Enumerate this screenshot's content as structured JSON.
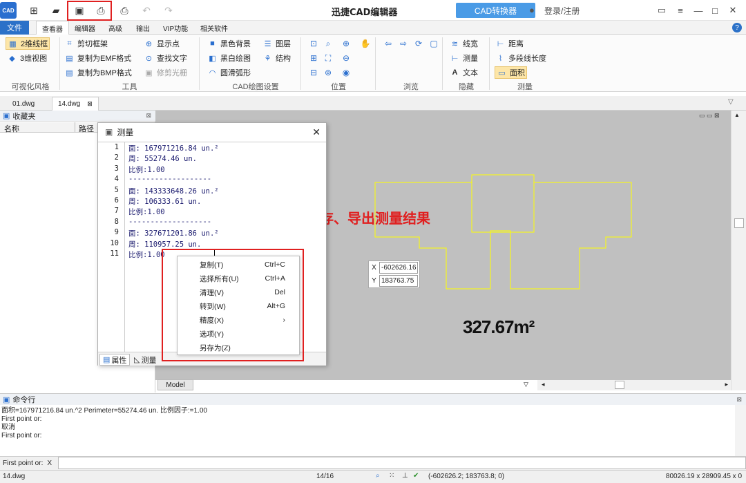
{
  "titlebar": {
    "logo_text": "CAD",
    "title": "迅捷CAD编辑器",
    "converter_label": "CAD转换器",
    "login_label": "登录/注册"
  },
  "ribbon_tabs": [
    "文件",
    "查看器",
    "编辑器",
    "高级",
    "输出",
    "VIP功能",
    "相关软件"
  ],
  "ribbon": {
    "visual_style": {
      "items": [
        "2维线框",
        "3维视图"
      ],
      "label": "可视化风格"
    },
    "tools": {
      "items": [
        "剪切框架",
        "复制为EMF格式",
        "复制为BMP格式",
        "显示点",
        "查找文字",
        "修剪光栅"
      ],
      "label": "工具"
    },
    "cad_settings": {
      "items": [
        "黑色背景",
        "黑白绘图",
        "圆滑弧形",
        "图层",
        "结构"
      ],
      "label": "CAD绘图设置"
    },
    "position": {
      "label": "位置"
    },
    "browse": {
      "label": "浏览"
    },
    "hide": {
      "items": [
        "线宽",
        "测量",
        "文本"
      ],
      "label": "隐藏"
    },
    "measure": {
      "items": [
        "距离",
        "多段线长度",
        "面积"
      ],
      "label": "测量"
    }
  },
  "doc_tabs": [
    "01.dwg",
    "14.dwg"
  ],
  "left_pane": {
    "title": "收藏夹",
    "col_name": "名称",
    "col_path": "路径"
  },
  "dialog": {
    "title": "测量",
    "lines": [
      {
        "n": "1",
        "t": "面: 167971216.84 un.²"
      },
      {
        "n": "2",
        "t": "周: 55274.46 un."
      },
      {
        "n": "3",
        "t": "比例:1.00"
      },
      {
        "n": "4",
        "t": "-------------------"
      },
      {
        "n": "5",
        "t": "面: 143333648.26 un.²"
      },
      {
        "n": "6",
        "t": "周: 106333.61 un."
      },
      {
        "n": "7",
        "t": "比例:1.00"
      },
      {
        "n": "8",
        "t": "-------------------"
      },
      {
        "n": "9",
        "t": "面: 327671201.86 un.²"
      },
      {
        "n": "10",
        "t": "周: 110957.25 un."
      },
      {
        "n": "11",
        "t": "比例:1.00"
      }
    ],
    "tab_properties": "属性",
    "tab_measure": "测量"
  },
  "context_menu": [
    {
      "label": "复制(T)",
      "key": "Ctrl+C"
    },
    {
      "label": "选择所有(U)",
      "key": "Ctrl+A"
    },
    {
      "label": "清理(V)",
      "key": "Del"
    },
    {
      "label": "转到(W)",
      "key": "Alt+G"
    },
    {
      "label": "精度(X)",
      "key": "›"
    },
    {
      "label": "选项(Y)",
      "key": ""
    },
    {
      "label": "另存为(Z)",
      "key": ""
    }
  ],
  "canvas": {
    "annotation": "复制、保存、导出测量结果",
    "area_label": "327.67m²",
    "coord_x_label": "X",
    "coord_x": "-602626.16",
    "coord_y_label": "Y",
    "coord_y": "183763.75",
    "model_tab": "Model"
  },
  "command": {
    "title": "命令行",
    "log": [
      "面积=167971216.84 un.^2 Perimeter=55274.46 un. 比例因子:=1.00",
      "First point or:",
      "取消",
      "First point or:"
    ],
    "prompt": "First point or:",
    "prompt_x": "X"
  },
  "statusbar": {
    "file": "14.dwg",
    "page": "14/16",
    "coords": "(-602626.2; 183763.8; 0)",
    "size": "80026.19 x 28909.45 x 0"
  },
  "colors": {
    "accent": "#2b71c8",
    "highlight_red": "#e02020",
    "canvas_bg": "#c0c0c0",
    "outline_yellow": "#ffff00"
  }
}
